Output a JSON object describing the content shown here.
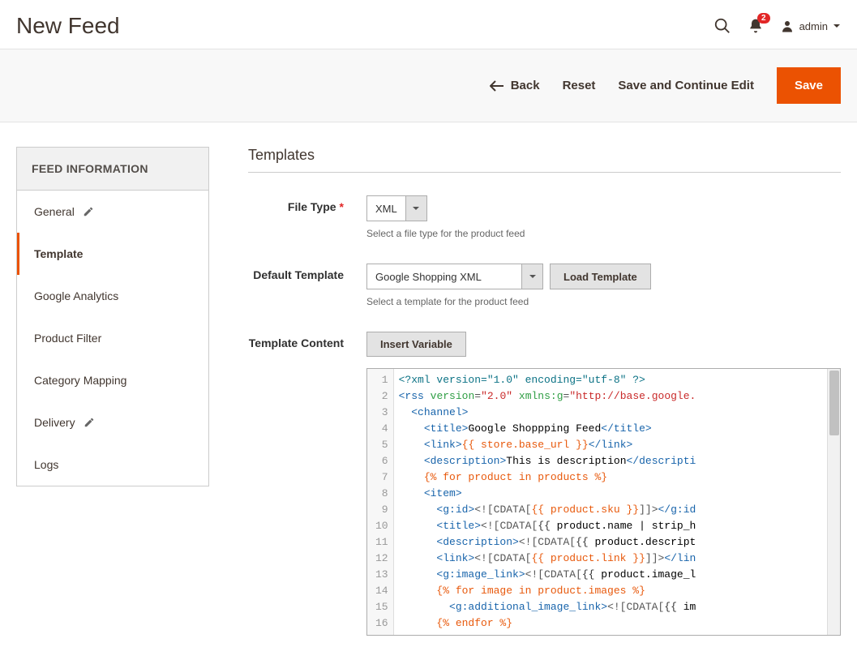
{
  "header": {
    "title": "New Feed",
    "notification_count": "2",
    "username": "admin"
  },
  "actions": {
    "back": "Back",
    "reset": "Reset",
    "save_continue": "Save and Continue Edit",
    "save": "Save"
  },
  "sidebar": {
    "header": "FEED INFORMATION",
    "items": [
      {
        "label": "General",
        "has_icon": true
      },
      {
        "label": "Template",
        "active": true
      },
      {
        "label": "Google Analytics"
      },
      {
        "label": "Product Filter"
      },
      {
        "label": "Category Mapping"
      },
      {
        "label": "Delivery",
        "has_icon": true
      },
      {
        "label": "Logs"
      }
    ]
  },
  "section": {
    "title": "Templates"
  },
  "form": {
    "file_type": {
      "label": "File Type",
      "value": "XML",
      "hint": "Select a file type for the product feed"
    },
    "default_template": {
      "label": "Default Template",
      "value": "Google Shopping XML",
      "button": "Load Template",
      "hint": "Select a template for the product feed"
    },
    "template_content": {
      "label": "Template Content",
      "button": "Insert Variable"
    }
  },
  "code": {
    "line_count": 16,
    "lines_text": [
      "<?xml version=\"1.0\" encoding=\"utf-8\" ?>",
      "<rss version=\"2.0\" xmlns:g=\"http://base.google.",
      "  <channel>",
      "    <title>Google Shoppping Feed</title>",
      "    <link>{{ store.base_url }}</link>",
      "    <description>This is description</descripti",
      "    {% for product in products %}",
      "    <item>",
      "      <g:id><![CDATA[{{ product.sku }}]]></g:id",
      "      <title><![CDATA[{{ product.name | strip_h",
      "      <description><![CDATA[{{ product.descript",
      "      <link><![CDATA[{{ product.link }}]]></lin",
      "      <g:image_link><![CDATA[{{ product.image_l",
      "      {% for image in product.images %}",
      "        <g:additional_image_link><![CDATA[{{ im",
      "      {% endfor %}"
    ]
  }
}
